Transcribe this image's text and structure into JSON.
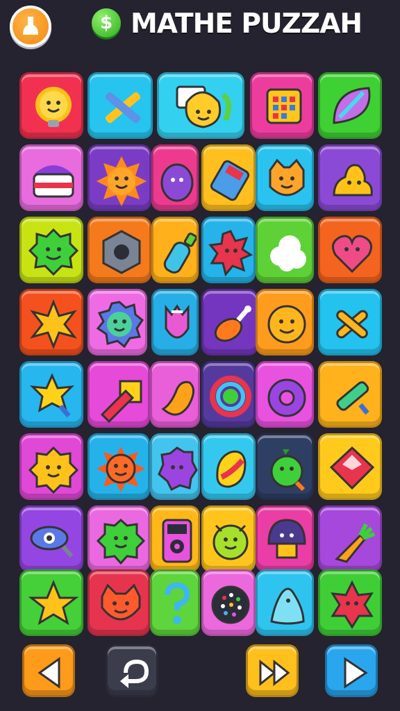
{
  "header": {
    "title": "MATHE PUZZAH",
    "coin_symbol": "$",
    "profile_icon": "person-icon"
  },
  "board": {
    "rows": [
      [
        {
          "name": "sun-bulb",
          "color": "#f1314f",
          "icon": "smiling-sun-bulb-icon"
        },
        {
          "name": "crossed-tools",
          "color": "#27c4ef",
          "icon": "crossed-pencil-tools-icon"
        },
        {
          "name": "smiling-blob-frame",
          "color": "#34d0f0",
          "icon": "smiling-blob-icon"
        },
        {
          "name": "calendar",
          "color": "#ec3d9f",
          "icon": "calendar-grid-icon"
        },
        {
          "name": "leaf",
          "color": "#3fd034",
          "icon": "purple-leaf-icon"
        }
      ],
      [
        {
          "name": "cake",
          "color": "#e86cde",
          "icon": "cake-icon"
        },
        {
          "name": "sun-face",
          "color": "#7b3cc5",
          "icon": "smiling-sun-icon"
        },
        {
          "name": "egg-face",
          "color": "#ec3b8f",
          "icon": "purple-egg-face-icon"
        },
        {
          "name": "battery",
          "color": "#ffbf1e",
          "icon": "battery-icon"
        },
        {
          "name": "cat-face",
          "color": "#2ac2ef",
          "icon": "orange-cat-face-icon"
        },
        {
          "name": "jelly-blob",
          "color": "#8b4ad6",
          "icon": "yellow-blob-icon"
        }
      ],
      [
        {
          "name": "green-monster",
          "color": "#c8e314",
          "icon": "green-monster-icon"
        },
        {
          "name": "hex-nut",
          "color": "#f57a1c",
          "icon": "hex-nut-icon"
        },
        {
          "name": "bottle",
          "color": "#ffb01b",
          "icon": "bottle-icon"
        },
        {
          "name": "spiky-ball",
          "color": "#25b3e9",
          "icon": "pink-spiky-ball-icon"
        },
        {
          "name": "cloud",
          "color": "#5ed136",
          "icon": "white-cloud-icon"
        },
        {
          "name": "heart-face",
          "color": "#f4641e",
          "icon": "pink-heart-face-icon"
        }
      ],
      [
        {
          "name": "gold-star",
          "color": "#f4511e",
          "icon": "gold-star-icon"
        },
        {
          "name": "blue-gear-face",
          "color": "#ef6be3",
          "icon": "smiling-gear-icon"
        },
        {
          "name": "tulip",
          "color": "#28aee6",
          "icon": "tulip-icon"
        },
        {
          "name": "drumstick",
          "color": "#7436bf",
          "icon": "drumstick-icon"
        },
        {
          "name": "smiley",
          "color": "#ff9c1d",
          "icon": "smiley-face-icon"
        },
        {
          "name": "crossed-bones",
          "color": "#23c2ef",
          "icon": "crossed-bones-icon"
        }
      ],
      [
        {
          "name": "star-wand",
          "color": "#27b6ee",
          "icon": "star-wand-icon"
        },
        {
          "name": "rocket",
          "color": "#e64ad8",
          "icon": "red-rocket-icon"
        },
        {
          "name": "bean",
          "color": "#e95ed9",
          "icon": "orange-bean-icon"
        },
        {
          "name": "rainbow-ring",
          "color": "#553a9e",
          "icon": "rainbow-ring-icon"
        },
        {
          "name": "purple-donut",
          "color": "#e852df",
          "icon": "purple-donut-icon"
        },
        {
          "name": "pen-drone",
          "color": "#ffb21b",
          "icon": "pen-drone-icon"
        }
      ],
      [
        {
          "name": "yellow-flower",
          "color": "#e048d6",
          "icon": "yellow-flower-face-icon"
        },
        {
          "name": "red-sun",
          "color": "#25b2ea",
          "icon": "red-sun-face-icon"
        },
        {
          "name": "purple-blob",
          "color": "#43c4ee",
          "icon": "purple-blob-face-icon"
        },
        {
          "name": "candy",
          "color": "#35c8ef",
          "icon": "candy-icon"
        },
        {
          "name": "green-pepper",
          "color": "#2f3e63",
          "icon": "green-pepper-face-icon"
        },
        {
          "name": "red-gem",
          "color": "#ffca1c",
          "icon": "red-gem-icon"
        }
      ],
      [
        {
          "name": "magnifier",
          "color": "#9446e2",
          "icon": "magnifier-eye-icon"
        },
        {
          "name": "green-slime",
          "color": "#ea69e1",
          "icon": "green-slime-face-icon"
        },
        {
          "name": "phone",
          "color": "#ffb719",
          "icon": "phone-icon"
        },
        {
          "name": "lemon-face",
          "color": "#ffc51d",
          "icon": "lemon-face-icon"
        },
        {
          "name": "mushroom",
          "color": "#ea3da5",
          "icon": "mushroom-face-icon"
        },
        {
          "name": "carrot",
          "color": "#a648dc",
          "icon": "carrot-icon"
        }
      ],
      [
        {
          "name": "yellow-star",
          "color": "#45cf38",
          "icon": "yellow-star-icon"
        },
        {
          "name": "red-cat",
          "color": "#e6344f",
          "icon": "red-cat-face-icon"
        },
        {
          "name": "question",
          "color": "#5ed53c",
          "icon": "question-mark-icon"
        },
        {
          "name": "dot-ball",
          "color": "#ec68dd",
          "icon": "dotted-ball-icon"
        },
        {
          "name": "ghost",
          "color": "#2ec4ef",
          "icon": "blue-ghost-icon"
        },
        {
          "name": "red-star-face",
          "color": "#3fce36",
          "icon": "red-star-face-icon"
        }
      ]
    ]
  },
  "controls": {
    "back": {
      "icon": "left-arrow-icon",
      "color": "#ff9b1a"
    },
    "undo": {
      "icon": "undo-icon",
      "color": "#3b3d4d"
    },
    "fast_forward": {
      "icon": "fast-forward-icon",
      "color": "#ffbf1d"
    },
    "play": {
      "icon": "play-icon",
      "color": "#2aa6ef"
    }
  }
}
